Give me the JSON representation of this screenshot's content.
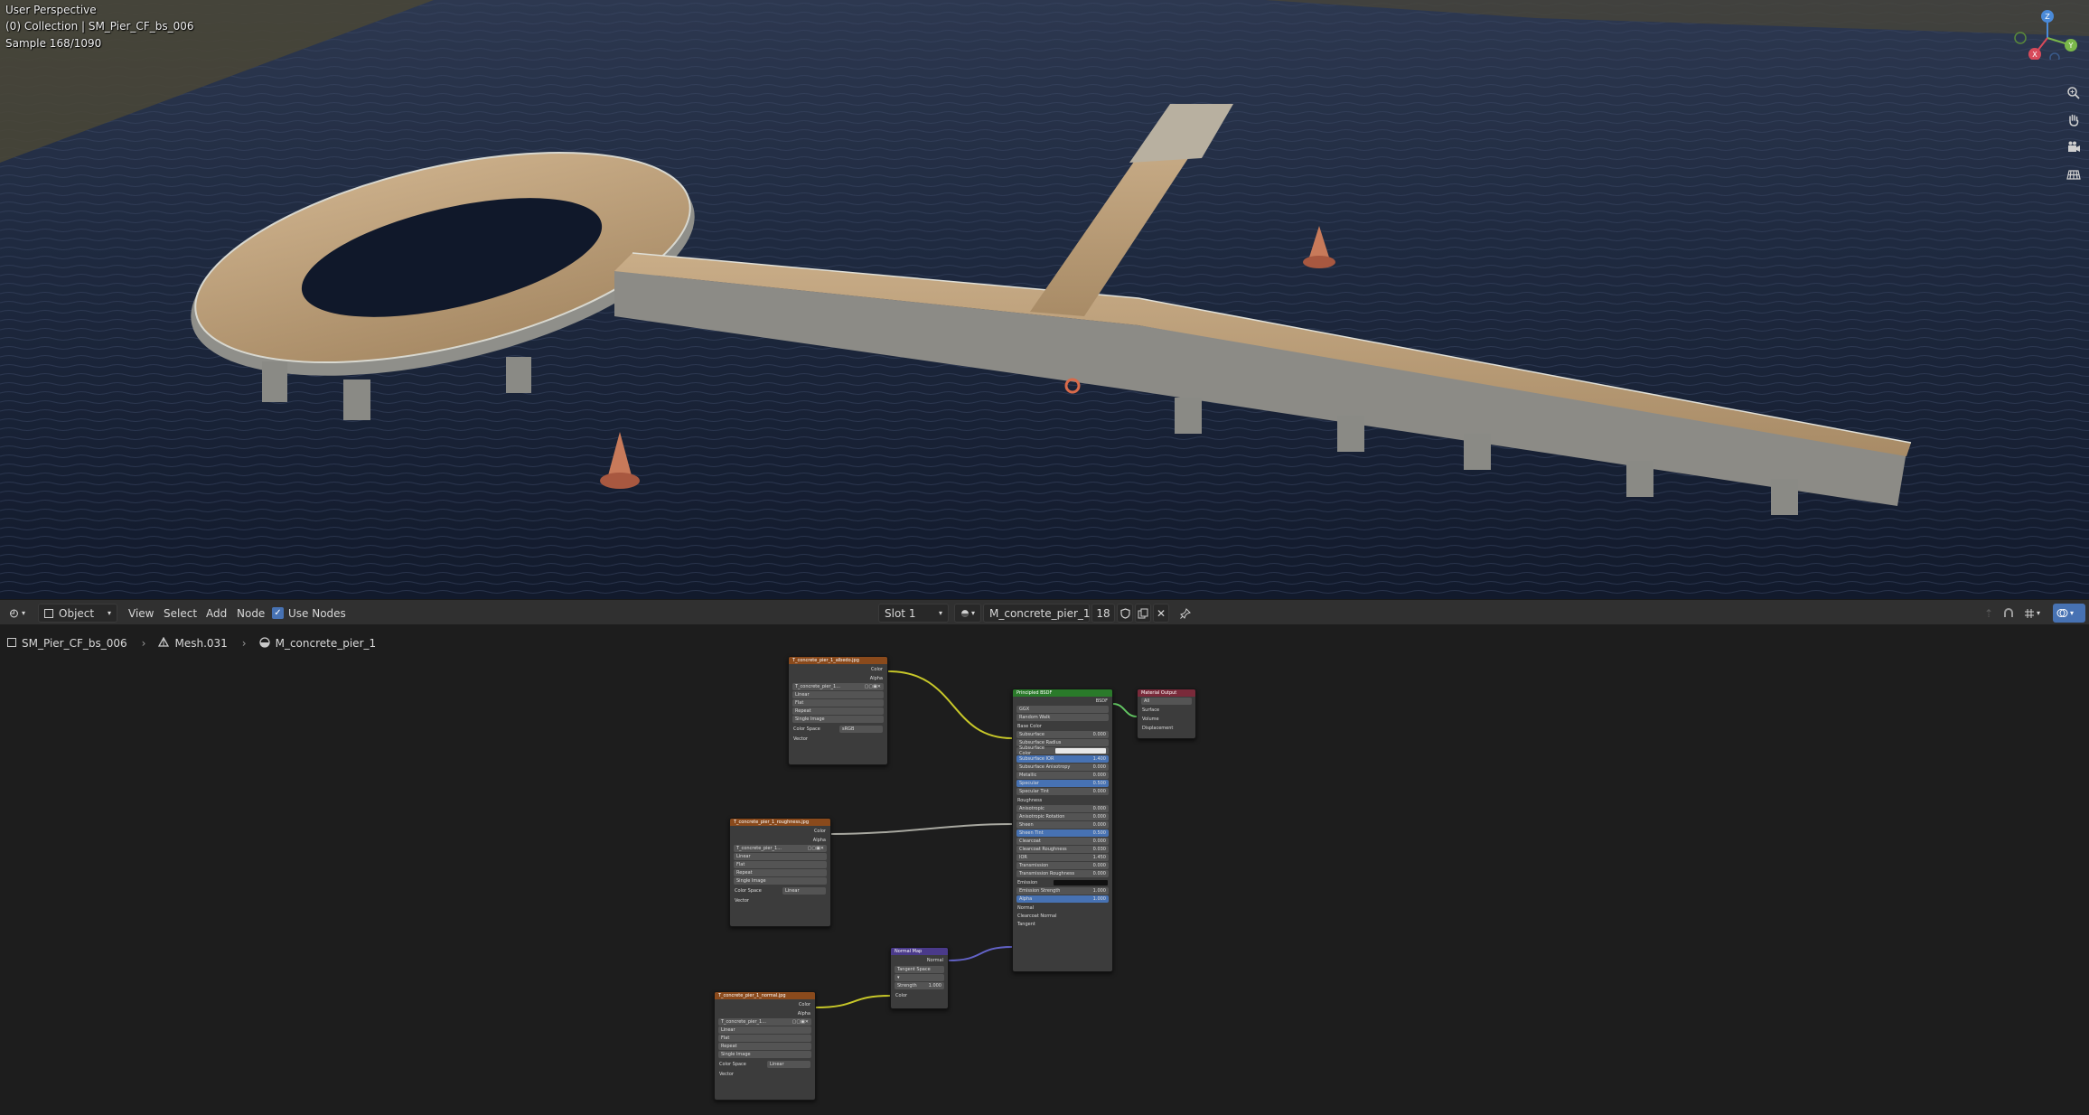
{
  "viewport": {
    "lines": [
      "User Perspective",
      "(0) Collection | SM_Pier_CF_bs_006",
      "Sample 168/1090"
    ],
    "gizmo": {
      "z": "Z",
      "y": "Y",
      "x": "X"
    },
    "tools": [
      "zoom-icon",
      "hand-icon",
      "camera-icon",
      "grid-icon"
    ]
  },
  "header": {
    "editor_type_icon": "node-editor-icon",
    "mode": "Object",
    "menus": [
      "View",
      "Select",
      "Add",
      "Node"
    ],
    "use_nodes_label": "Use Nodes",
    "use_nodes_checked": true,
    "slot": "Slot 1",
    "material_name": "M_concrete_pier_1",
    "user_count": "18"
  },
  "breadcrumb": {
    "object": "SM_Pier_CF_bs_006",
    "mesh": "Mesh.031",
    "material": "M_concrete_pier_1"
  },
  "nodes": {
    "albedo": {
      "title": "T_concrete_pier_1_albedo.jpg",
      "outputs": [
        "Color",
        "Alpha"
      ],
      "image": "T_concrete_pier_1...",
      "options": [
        "Linear",
        "Flat",
        "Repeat",
        "Single Image"
      ],
      "color_space_label": "Color Space",
      "color_space": "sRGB",
      "input": "Vector"
    },
    "roughness": {
      "title": "T_concrete_pier_1_roughness.jpg",
      "outputs": [
        "Color",
        "Alpha"
      ],
      "image": "T_concrete_pier_1...",
      "options": [
        "Linear",
        "Flat",
        "Repeat",
        "Single Image"
      ],
      "color_space_label": "Color Space",
      "color_space": "Linear",
      "input": "Vector"
    },
    "normal": {
      "title": "T_concrete_pier_1_normal.jpg",
      "outputs": [
        "Color",
        "Alpha"
      ],
      "image": "T_concrete_pier_1...",
      "options": [
        "Linear",
        "Flat",
        "Repeat",
        "Single Image"
      ],
      "color_space_label": "Color Space",
      "color_space": "Linear",
      "input": "Vector"
    },
    "normal_map": {
      "title": "Normal Map",
      "output": "Normal",
      "space": "Tangent Space",
      "strength_label": "Strength",
      "strength": "1.000",
      "input": "Color"
    },
    "bsdf": {
      "title": "Principled BSDF",
      "output": "BSDF",
      "distribution": "GGX",
      "subsurface_method": "Random Walk",
      "base_color": "Base Color",
      "rows": [
        {
          "label": "Subsurface",
          "value": "0.000"
        },
        {
          "label": "Subsurface Radius",
          "value": ""
        },
        {
          "label": "Subsurface Color",
          "value": ""
        },
        {
          "label": "Subsurface IOR",
          "value": "1.400"
        },
        {
          "label": "Subsurface Anisotropy",
          "value": "0.000"
        },
        {
          "label": "Metallic",
          "value": "0.000"
        },
        {
          "label": "Specular",
          "value": "0.500"
        },
        {
          "label": "Specular Tint",
          "value": "0.000"
        },
        {
          "label": "Roughness",
          "value": ""
        },
        {
          "label": "Anisotropic",
          "value": "0.000"
        },
        {
          "label": "Anisotropic Rotation",
          "value": "0.000"
        },
        {
          "label": "Sheen",
          "value": "0.000"
        },
        {
          "label": "Sheen Tint",
          "value": "0.500"
        },
        {
          "label": "Clearcoat",
          "value": "0.000"
        },
        {
          "label": "Clearcoat Roughness",
          "value": "0.030"
        },
        {
          "label": "IOR",
          "value": "1.450"
        },
        {
          "label": "Transmission",
          "value": "0.000"
        },
        {
          "label": "Transmission Roughness",
          "value": "0.000"
        },
        {
          "label": "Emission",
          "value": ""
        },
        {
          "label": "Emission Strength",
          "value": "1.000"
        },
        {
          "label": "Alpha",
          "value": "1.000"
        },
        {
          "label": "Normal",
          "value": ""
        },
        {
          "label": "Clearcoat Normal",
          "value": ""
        },
        {
          "label": "Tangent",
          "value": ""
        }
      ]
    },
    "output": {
      "title": "Material Output",
      "target": "All",
      "inputs": [
        "Surface",
        "Volume",
        "Displacement"
      ]
    }
  }
}
